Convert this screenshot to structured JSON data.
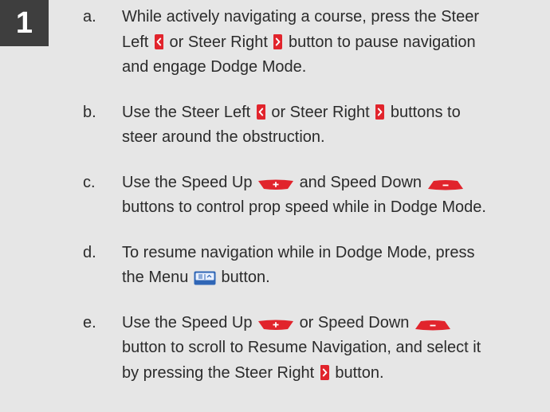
{
  "step": {
    "number": "1"
  },
  "items": [
    {
      "letter": "a.",
      "lines": [
        {
          "t1": "While actively navigating a course, press the Steer"
        },
        {
          "t1": "Left",
          "icon1": "steer-left-icon",
          "t2": "or Steer Right",
          "icon2": "steer-right-icon",
          "t3": "button to pause navigation"
        },
        {
          "t1": "and engage Dodge Mode."
        }
      ]
    },
    {
      "letter": "b.",
      "lines": [
        {
          "t1": "Use the Steer Left",
          "icon1": "steer-left-icon",
          "t2": "or Steer Right",
          "icon2": "steer-right-icon",
          "t3": "buttons to"
        },
        {
          "t1": "steer around the obstruction."
        }
      ]
    },
    {
      "letter": "c.",
      "lines": [
        {
          "t1": "Use the Speed Up",
          "icon1": "speed-up-icon",
          "t2": "and Speed Down",
          "icon2": "speed-down-icon"
        },
        {
          "t1": "buttons to control prop speed while in Dodge Mode."
        }
      ]
    },
    {
      "letter": "d.",
      "lines": [
        {
          "t1": "To resume navigation while in Dodge Mode, press"
        },
        {
          "t1": "the Menu",
          "icon1": "menu-button-icon",
          "t2": "button."
        }
      ]
    },
    {
      "letter": "e.",
      "lines": [
        {
          "t1": "Use the Speed Up",
          "icon1": "speed-up-icon",
          "t2": "or Speed Down",
          "icon2": "speed-down-icon"
        },
        {
          "t1": "button to scroll to Resume Navigation, and select it"
        },
        {
          "t1": "by pressing the Steer Right",
          "icon1": "steer-right-icon",
          "t2": "button."
        }
      ]
    }
  ],
  "colors": {
    "background": "#e6e6e6",
    "badge": "#3e3e3e",
    "text": "#2b2b2b",
    "button_red": "#e1242c",
    "menu_blue": "#2f66b6"
  }
}
